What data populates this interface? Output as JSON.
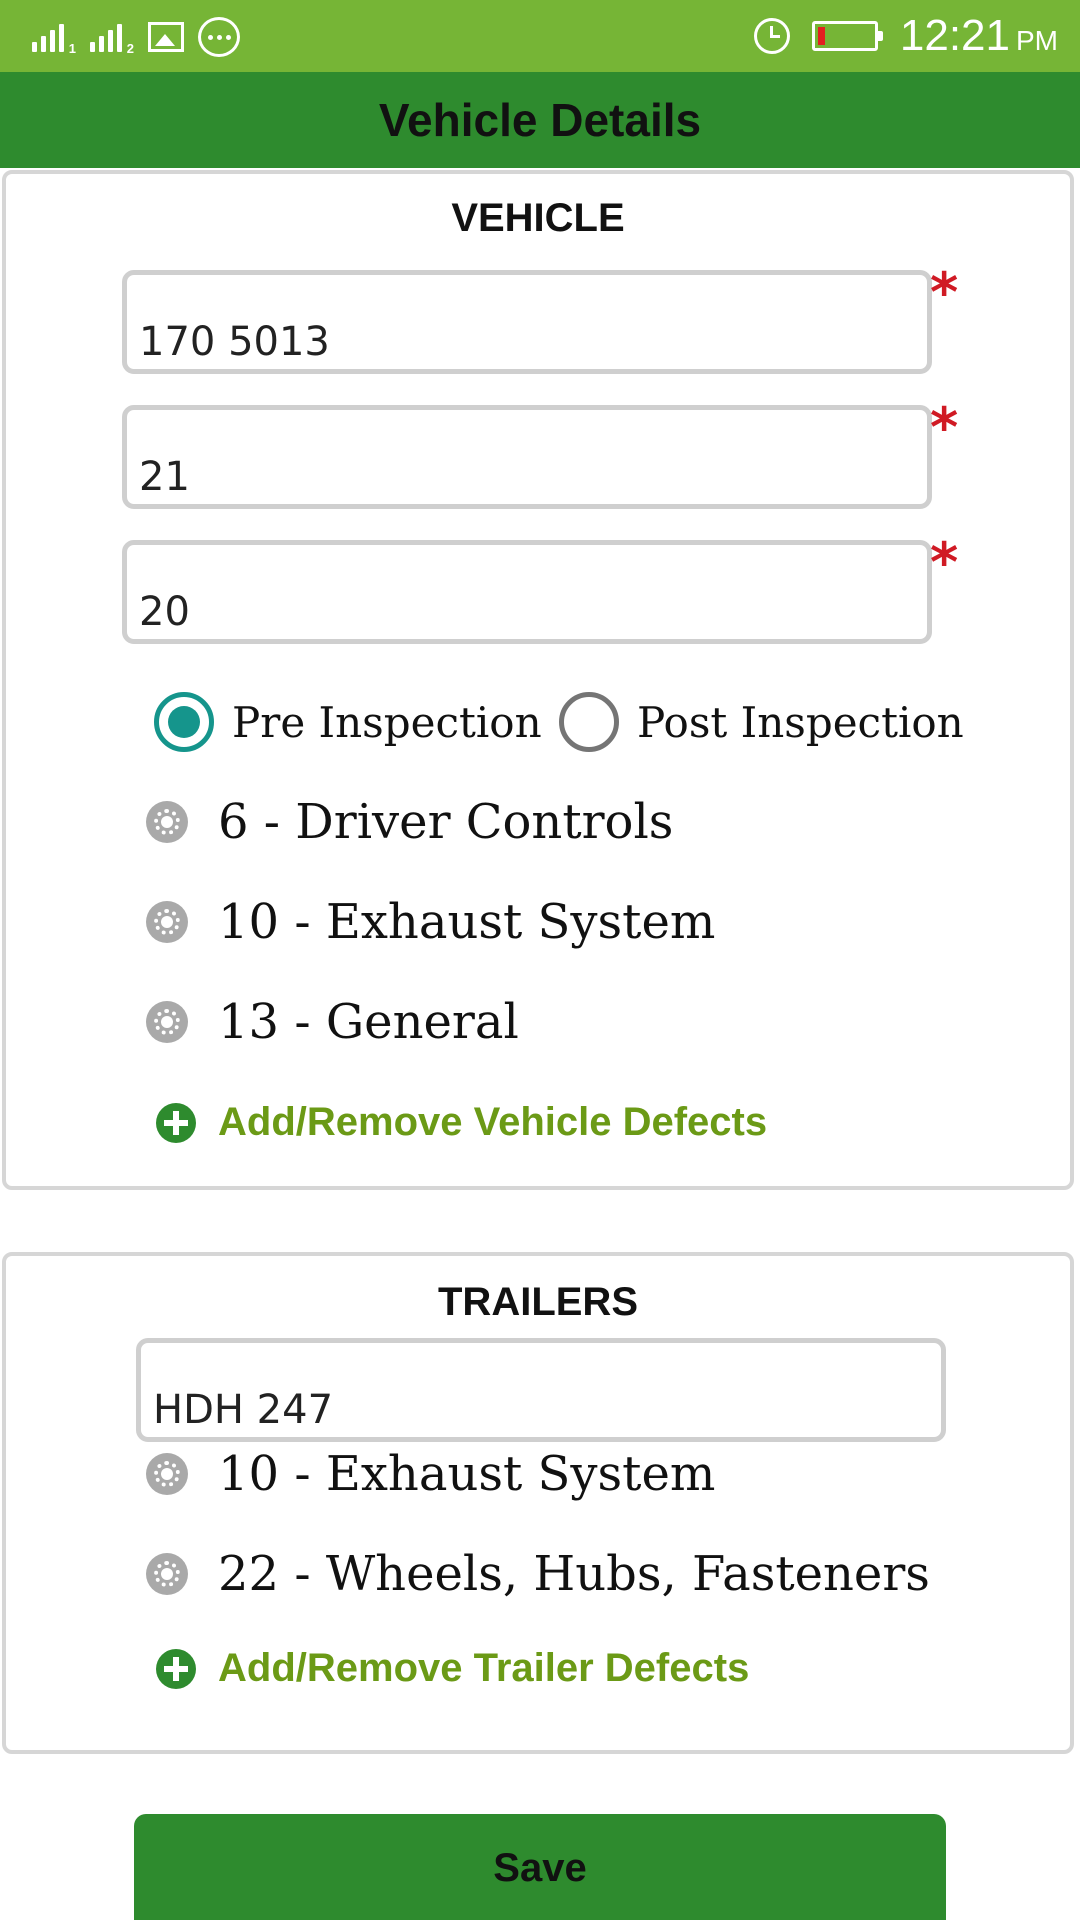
{
  "status_bar": {
    "sim1_label": "1",
    "sim2_label": "2",
    "time": "12:21",
    "ampm": "PM",
    "battery_level": 0.12,
    "battery_color": "#e32020",
    "icons": [
      "signal-sim1-icon",
      "signal-sim2-icon",
      "image-notification-icon",
      "chat-notification-icon",
      "alarm-icon",
      "battery-icon"
    ]
  },
  "app_bar": {
    "title": "Vehicle Details"
  },
  "vehicle": {
    "section_title": "VEHICLE",
    "required_marker": "*",
    "fields": [
      {
        "value": "170 5013"
      },
      {
        "value": "21"
      },
      {
        "value": "20"
      }
    ],
    "inspection_options": [
      {
        "label": "Pre Inspection",
        "selected": true
      },
      {
        "label": "Post Inspection",
        "selected": false
      }
    ],
    "defects": [
      {
        "label": "6 - Driver Controls"
      },
      {
        "label": "10 - Exhaust System"
      },
      {
        "label": "13 - General"
      }
    ],
    "add_defects_label": "Add/Remove Vehicle Defects"
  },
  "trailers": {
    "section_title": "TRAILERS",
    "field": {
      "value": "HDH 247"
    },
    "defects": [
      {
        "label": "10 - Exhaust System"
      },
      {
        "label": "22 - Wheels, Hubs, Fasteners"
      }
    ],
    "add_defects_label": "Add/Remove Trailer Defects"
  },
  "save_label": "Save",
  "colors": {
    "status_bar": "#76b536",
    "app_bar": "#2e8b2e",
    "required": "#d01a24",
    "radio_selected": "#15958c",
    "link": "#6b9a16"
  }
}
